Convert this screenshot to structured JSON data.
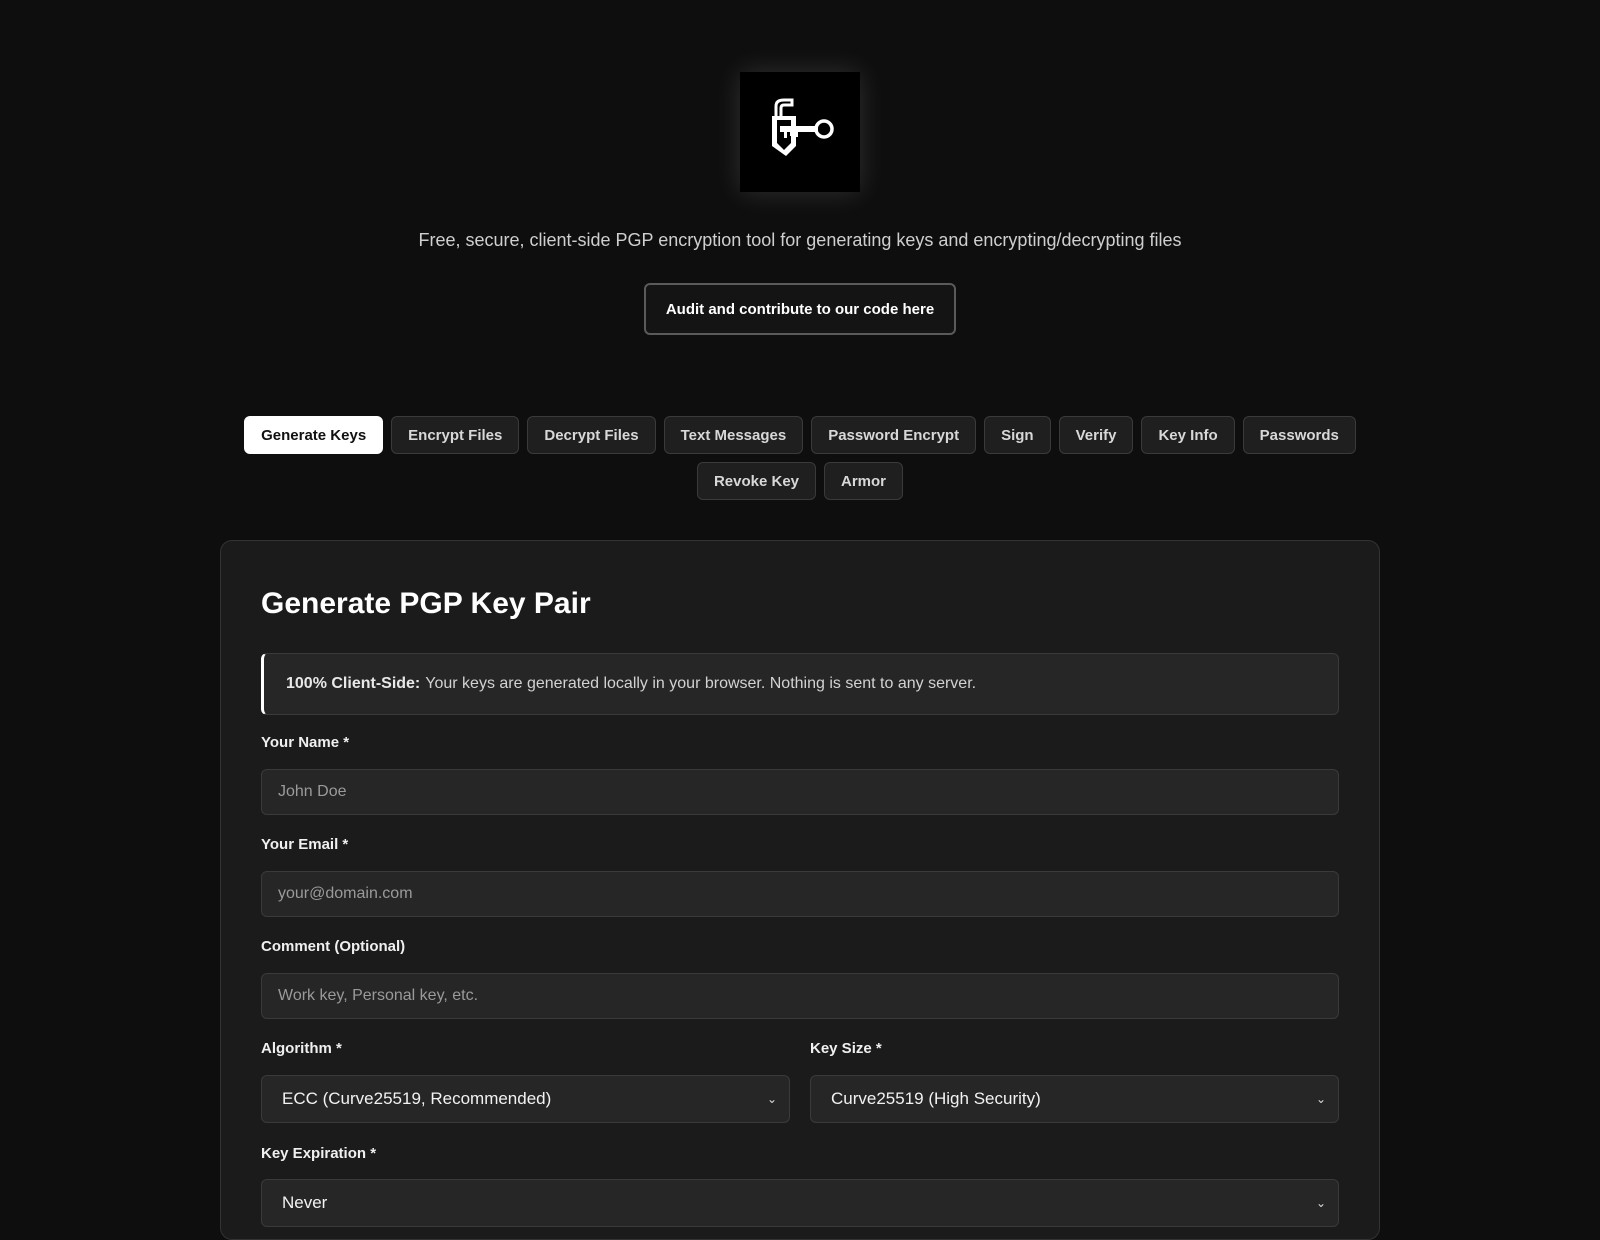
{
  "header": {
    "logo_icon": "lock-key-icon",
    "tagline": "Free, secure, client-side PGP encryption tool for generating keys and encrypting/decrypting files",
    "audit_button": "Audit and contribute to our code here"
  },
  "tabs": {
    "row1": [
      "Generate Keys",
      "Encrypt Files",
      "Decrypt Files",
      "Text Messages",
      "Password Encrypt",
      "Sign",
      "Verify",
      "Key Info",
      "Passwords"
    ],
    "row2": [
      "Revoke Key",
      "Armor"
    ],
    "active": "Generate Keys"
  },
  "form": {
    "title": "Generate PGP Key Pair",
    "notice_bold": "100% Client-Side:",
    "notice_text": "Your keys are generated locally in your browser. Nothing is sent to any server.",
    "name_label": "Your Name *",
    "name_placeholder": "John Doe",
    "email_label": "Your Email *",
    "email_placeholder": "your@domain.com",
    "comment_label": "Comment (Optional)",
    "comment_placeholder": "Work key, Personal key, etc.",
    "algorithm_label": "Algorithm *",
    "algorithm_value": "ECC (Curve25519, Recommended)",
    "keysize_label": "Key Size *",
    "keysize_value": "Curve25519 (High Security)",
    "expiration_label": "Key Expiration *",
    "expiration_value": "Never"
  }
}
